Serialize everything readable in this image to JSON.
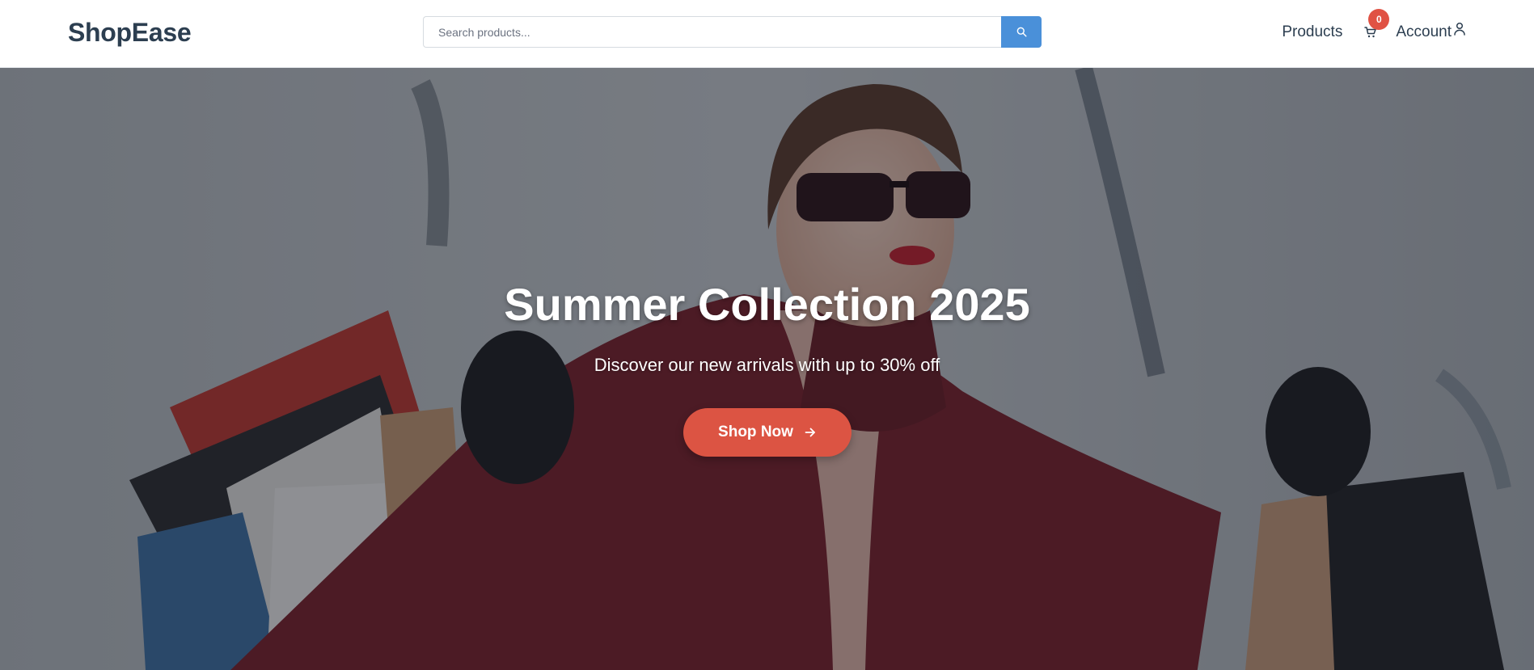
{
  "brand": {
    "logo_text": "ShopEase"
  },
  "search": {
    "placeholder": "Search products...",
    "value": "",
    "button_icon": "search-icon"
  },
  "nav": {
    "products_label": "Products",
    "cart_icon": "cart-icon",
    "cart_count": "0",
    "account_label": "Account",
    "account_icon": "user-icon"
  },
  "hero": {
    "title": "Summer Collection 2025",
    "subtitle": "Discover our new arrivals with up to 30% off",
    "cta_label": "Shop Now",
    "cta_icon": "arrow-right-icon"
  },
  "colors": {
    "brand_text": "#2c3e50",
    "search_button": "#4a90d9",
    "accent": "#dc5443",
    "badge": "#e05244"
  }
}
